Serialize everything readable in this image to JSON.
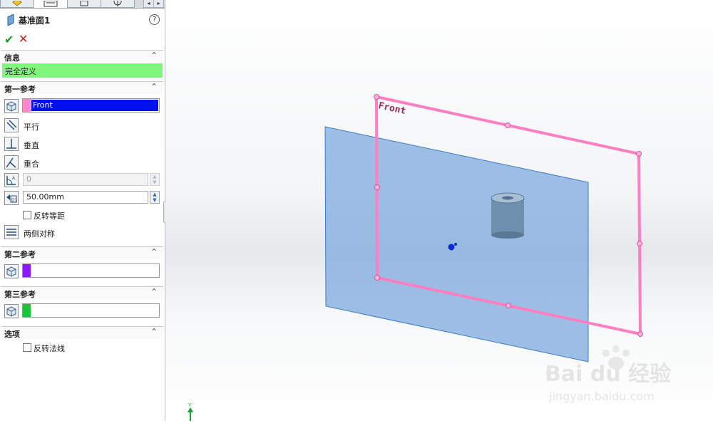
{
  "feature": {
    "title": "基准面1",
    "help_icon": "?",
    "ok_icon": "✔",
    "cancel_icon": "✕"
  },
  "sections": {
    "info": {
      "header": "信息",
      "status": "完全定义",
      "status_color": "#7ff77f"
    },
    "first_ref": {
      "header": "第一参考",
      "selection": "Front",
      "selection_color": "#ff88c8",
      "constraints": [
        "平行",
        "垂直",
        "重合"
      ],
      "angle_value": "0",
      "distance_value": "50.00mm",
      "flip_offset_label": "反转等距",
      "mid_plane_label": "两侧对称"
    },
    "second_ref": {
      "header": "第二参考",
      "selection": "",
      "color": "#8a1bff"
    },
    "third_ref": {
      "header": "第三参考",
      "selection": "",
      "color": "#19c53b"
    },
    "options": {
      "header": "选项",
      "flip_normal_label": "反转法线"
    }
  },
  "viewport": {
    "plane_label": "Front",
    "axis_label": "Y",
    "watermark_brand": "Bai du 经验",
    "watermark_url": "jingyan.baidu.com"
  }
}
